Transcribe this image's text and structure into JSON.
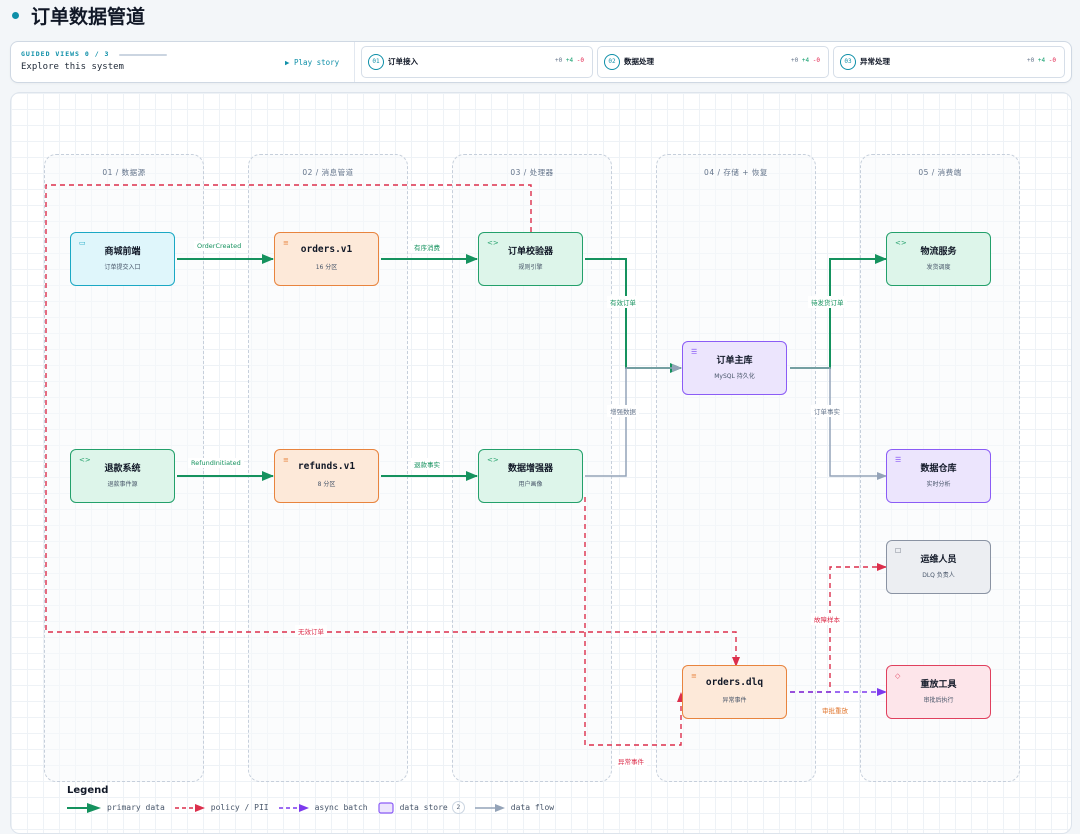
{
  "header": {
    "title": "订单数据管道"
  },
  "guide": {
    "kicker": "GUIDED VIEWS 0 / 3",
    "subtitle": "Explore this system",
    "play_label": "▶ Play story",
    "steps": [
      {
        "num": "01",
        "label": "订单接入",
        "plus": "+4",
        "minus": "-0",
        "zero": "+0"
      },
      {
        "num": "02",
        "label": "数据处理",
        "plus": "+4",
        "minus": "-0",
        "zero": "+0"
      },
      {
        "num": "03",
        "label": "异常处理",
        "plus": "+4",
        "minus": "-0",
        "zero": "+0"
      }
    ]
  },
  "lanes": [
    {
      "title": "01 / 数据源"
    },
    {
      "title": "02 / 消息管道"
    },
    {
      "title": "03 / 处理器"
    },
    {
      "title": "04 / 存储 + 恢复"
    },
    {
      "title": "05 / 消费端"
    }
  ],
  "nodes": {
    "mall": {
      "title": "商城前端",
      "sub": "订单提交入口",
      "icon": "window-icon"
    },
    "refund_sys": {
      "title": "退款系统",
      "sub": "退款事件源",
      "icon": "code-icon"
    },
    "orders_v1": {
      "title": "orders.v1",
      "sub": "16 分区",
      "icon": "stack-icon"
    },
    "refunds_v1": {
      "title": "refunds.v1",
      "sub": "8 分区",
      "icon": "stack-icon"
    },
    "validator": {
      "title": "订单校验器",
      "sub": "规则引擎",
      "icon": "code-icon"
    },
    "enricher": {
      "title": "数据增强器",
      "sub": "用户画像",
      "icon": "code-icon"
    },
    "main_db": {
      "title": "订单主库",
      "sub": "MySQL 持久化",
      "icon": "database-icon"
    },
    "dlq": {
      "title": "orders.dlq",
      "sub": "异常事件",
      "icon": "stack-icon"
    },
    "logistics": {
      "title": "物流服务",
      "sub": "发货调度",
      "icon": "code-icon"
    },
    "warehouse": {
      "title": "数据仓库",
      "sub": "实时分析",
      "icon": "database-icon"
    },
    "ops": {
      "title": "运维人员",
      "sub": "DLQ 负责人",
      "icon": "person-icon"
    },
    "replay": {
      "title": "重放工具",
      "sub": "审批后执行",
      "icon": "shield-icon"
    }
  },
  "edges": {
    "order_created": "OrderCreated",
    "refund_initiated": "RefundInitiated",
    "ordered_consume": "有序消费",
    "refund_fact": "退款事实",
    "valid_orders": "有效订单",
    "enriched_data": "增强数据",
    "to_ship": "待发货订单",
    "order_facts": "订单事实",
    "invalid_orders": "无效订单",
    "exception_events": "异常事件",
    "fault_samples": "故障样本",
    "approved_replay": "审批重放"
  },
  "legend": {
    "title": "Legend",
    "primary": "primary data",
    "policy": "policy / PII",
    "async": "async batch",
    "store": "data store",
    "store_count": "2",
    "flow": "data flow"
  },
  "colors": {
    "accent": "#0e8fa8",
    "primary_edge": "#15925e",
    "policy_edge": "#dc2f4c",
    "async_edge": "#7c3aed",
    "flow_edge": "#94a3b8"
  }
}
